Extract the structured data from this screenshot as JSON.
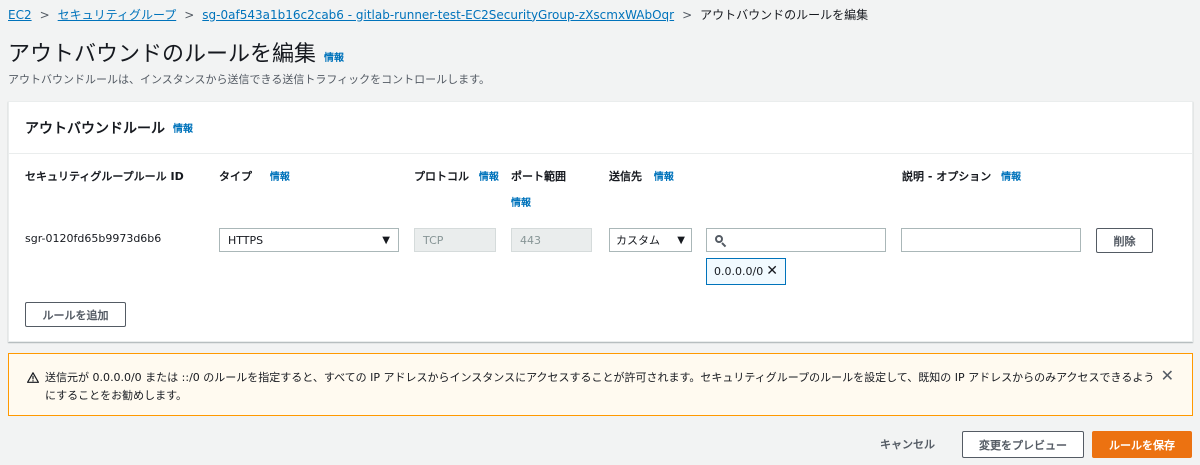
{
  "breadcrumb": {
    "items": [
      "EC2",
      "セキュリティグループ",
      "sg-0af543a1b16c2cab6 - gitlab-runner-test-EC2SecurityGroup-zXscmxWAbOqr"
    ],
    "current": "アウトバウンドのルールを編集"
  },
  "header": {
    "title": "アウトバウンドのルールを編集",
    "info": "情報",
    "description": "アウトバウンドルールは、インスタンスから送信できる送信トラフィックをコントロールします。"
  },
  "panel": {
    "title": "アウトバウンドルール",
    "info": "情報",
    "columns": {
      "rule_id": "セキュリティグループルール ID",
      "type": "タイプ",
      "protocol": "プロトコル",
      "port_range": "ポート範囲",
      "destination": "送信先",
      "description": "説明 - オプション"
    },
    "row": {
      "rule_id": "sgr-0120fd65b9973d6b6",
      "type": "HTTPS",
      "protocol": "TCP",
      "port": "443",
      "destination_type": "カスタム",
      "destination_search": "",
      "destination_token": "0.0.0.0/0",
      "description_value": "",
      "delete_label": "削除"
    },
    "add_rule_label": "ルールを追加"
  },
  "warning": {
    "text": "送信元が 0.0.0.0/0 または ::/0 のルールを指定すると、すべての IP アドレスからインスタンスにアクセスすることが許可されます。セキュリティグループのルールを設定して、既知の IP アドレスからのみアクセスできるようにすることをお勧めします。"
  },
  "footer": {
    "cancel_label": "キャンセル",
    "preview_label": "変更をプレビュー",
    "save_label": "ルールを保存"
  },
  "colors": {
    "link": "#0073bb",
    "primary": "#ec7211",
    "warning_border": "#ff9900"
  }
}
